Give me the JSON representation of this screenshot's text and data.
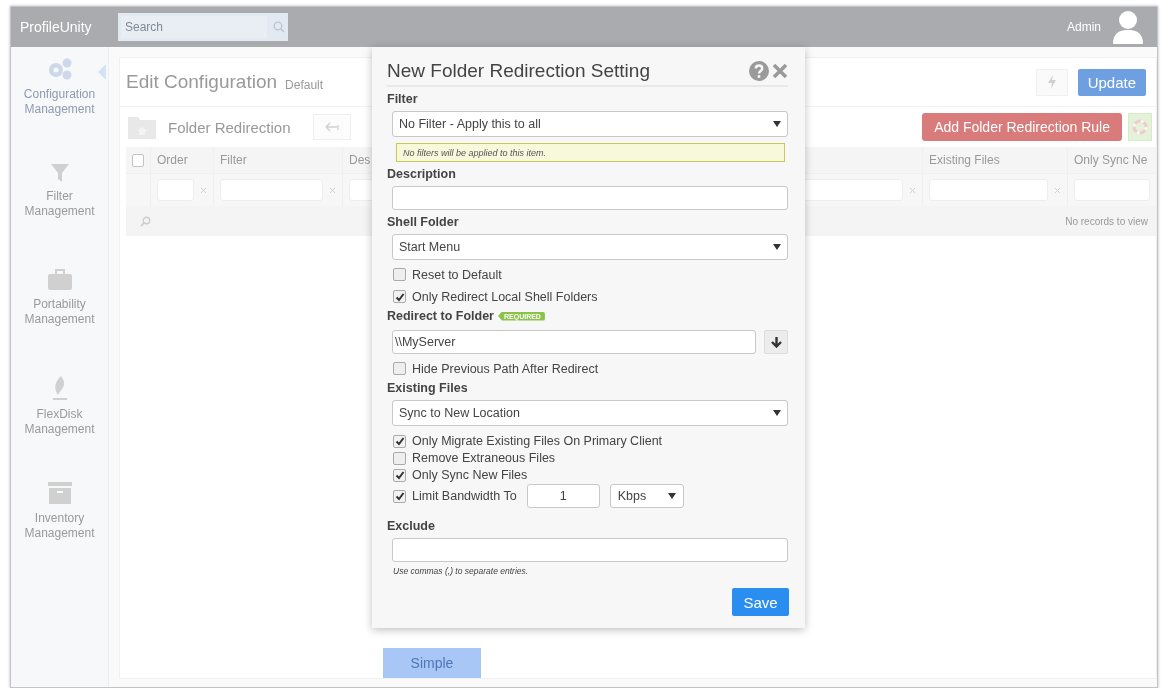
{
  "topbar": {
    "brand": "ProfileUnity",
    "search": {
      "placeholder": "Search"
    },
    "user": "Admin"
  },
  "sidebar": {
    "items": [
      {
        "label": "Configuration Management",
        "selected": true
      },
      {
        "label": "Filter Management",
        "selected": false
      },
      {
        "label": "Portability Management",
        "selected": false
      },
      {
        "label": "FlexDisk Management",
        "selected": false
      },
      {
        "label": "Inventory Management",
        "selected": false
      }
    ]
  },
  "page": {
    "title": "Edit Configuration",
    "subtitle": "Default",
    "update_button": "Update",
    "section": "Folder Redirection",
    "add_button": "Add Folder Redirection Rule",
    "simple_button": "Simple"
  },
  "grid": {
    "select_all": {
      "checked": false
    },
    "columns": [
      {
        "label": "Order"
      },
      {
        "label": "Filter"
      },
      {
        "label": "Des"
      },
      {
        "label": "Existing Files"
      },
      {
        "label": "Only Sync Ne"
      }
    ],
    "empty_message": "No records to view"
  },
  "dialog": {
    "title": "New Folder Redirection Setting",
    "save_button": "Save",
    "rows": [
      {
        "kind": "label",
        "text": "Filter"
      },
      {
        "kind": "select",
        "value": "No Filter - Apply this to all"
      },
      {
        "kind": "note",
        "text": "No filters will be applied to this item."
      },
      {
        "kind": "label",
        "text": "Description"
      },
      {
        "kind": "input"
      },
      {
        "kind": "label",
        "text": "Shell Folder"
      },
      {
        "kind": "select",
        "value": "Start Menu"
      },
      {
        "kind": "checkbox",
        "text": "Reset to Default",
        "checked": false
      },
      {
        "kind": "checkbox",
        "text": "Only Redirect Local Shell Folders",
        "checked": true
      },
      {
        "kind": "label",
        "text": "Redirect to Folder",
        "badge": "REQUIRED"
      },
      {
        "kind": "input_button",
        "value": "\\\\MyServer"
      },
      {
        "kind": "checkbox",
        "text": "Hide Previous Path After Redirect",
        "checked": false
      },
      {
        "kind": "label",
        "text": "Existing Files"
      },
      {
        "kind": "select",
        "value": "Sync to New Location"
      },
      {
        "kind": "checks",
        "items": [
          {
            "text": "Only Migrate Existing Files On Primary Client",
            "checked": true
          },
          {
            "text": "Remove Extraneous Files",
            "checked": false
          },
          {
            "text": "Only Sync New Files",
            "checked": true
          },
          {
            "text": "Limit Bandwidth To",
            "checked": true,
            "amount": "1",
            "unit": "Kbps"
          }
        ]
      },
      {
        "kind": "label",
        "text": "Exclude"
      },
      {
        "kind": "input"
      },
      {
        "kind": "help",
        "text": "Use commas (,) to separate entries."
      }
    ]
  }
}
